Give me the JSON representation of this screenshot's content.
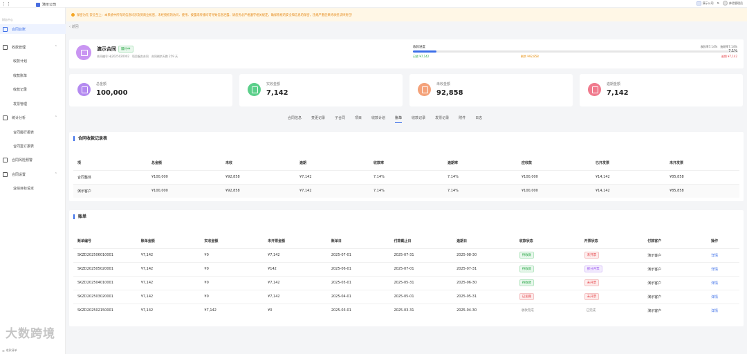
{
  "header": {
    "company": "演示公司",
    "right_company": "演示公司",
    "right_switch": "⇅",
    "user": "体验管理员"
  },
  "sidebar": {
    "section": "财务中心",
    "items": [
      {
        "label": "合同台账",
        "type": "item",
        "active": true
      },
      {
        "label": "收款管理",
        "type": "group"
      },
      {
        "label": "收款计划",
        "type": "sub"
      },
      {
        "label": "收款账单",
        "type": "sub"
      },
      {
        "label": "收款记录",
        "type": "sub"
      },
      {
        "label": "发票管理",
        "type": "sub"
      },
      {
        "label": "统计分析",
        "type": "group"
      },
      {
        "label": "合同履行报表",
        "type": "sub"
      },
      {
        "label": "合同签订报表",
        "type": "sub"
      },
      {
        "label": "合同风险预警",
        "type": "item"
      },
      {
        "label": "合同设置",
        "type": "group"
      },
      {
        "label": "业绩目标设定",
        "type": "sub"
      }
    ],
    "footer": "收款清单",
    "watermark": "大数跨境"
  },
  "notice": "保密为先 安全至上：本系统中所有的信息均涉及到商业机密，未经授权的访问、使用、披露或传播均可导致信息泄露，请您务必严格遵守相关规定，确保系统的安全和信息的保密，违规严重后果将承担法律责任！",
  "back": "返回",
  "contract": {
    "name": "演示合同",
    "status": "履约中",
    "meta": "合同编号 HJ2025020002　项目服务合同　合同剩余天数 259 天",
    "progress_label": "收款进度",
    "progress_pct_value": 7.14,
    "rate_text": "收款率7.14%　逾期率7.14%",
    "pct_text": "7.1%",
    "paid_text": "已收 ¥7,142",
    "remain_text": "剩余 ¥92,858",
    "overdue_text": "逾期 ¥7,142"
  },
  "stats": [
    {
      "label": "总金额",
      "value": "100,000",
      "color": "#b48af0"
    },
    {
      "label": "实收金额",
      "value": "7,142",
      "color": "#5bcf8a"
    },
    {
      "label": "未收金额",
      "value": "92,858",
      "color": "#f4a27a"
    },
    {
      "label": "逾期金额",
      "value": "7,142",
      "color": "#f07a8d"
    }
  ],
  "tabs": [
    "合同信息",
    "变更记录",
    "子合同",
    "项目",
    "收款计划",
    "账单",
    "收款记录",
    "发票记录",
    "附件",
    "日志"
  ],
  "active_tab": "账单",
  "summary": {
    "title": "合同收款记录表",
    "headers": [
      "项",
      "总金额",
      "未收",
      "逾期",
      "收款率",
      "逾期率",
      "应收款",
      "已开发票",
      "未开发票"
    ],
    "rows": [
      [
        "合同整体",
        "¥100,000",
        "¥92,858",
        "¥7,142",
        "7.14%",
        "7.14%",
        "¥100,000",
        "¥14,142",
        "¥85,858"
      ],
      [
        "演示客户",
        "¥100,000",
        "¥92,858",
        "¥7,142",
        "7.14%",
        "7.14%",
        "¥100,000",
        "¥14,142",
        "¥85,858"
      ]
    ]
  },
  "bills": {
    "title": "账单",
    "headers": [
      "账单编号",
      "账单金额",
      "实收金额",
      "未开票金额",
      "账单日",
      "付款截止日",
      "逾期日",
      "收款状态",
      "开票状态",
      "付款客户",
      "操作"
    ],
    "rows": [
      {
        "no": "SKZD202506010001",
        "amount": "¥7,142",
        "received": "¥0",
        "uninvoiced": "¥7,142",
        "bill_date": "2025-07-01",
        "due": "2025-07-31",
        "overdue": "2025-08-30",
        "status": "待收款",
        "status_tone": "green",
        "invoice": "未开票",
        "invoice_tone": "red",
        "customer": "演示客户",
        "action": "详情"
      },
      {
        "no": "SKZD202505020001",
        "amount": "¥7,142",
        "received": "¥0",
        "uninvoiced": "¥142",
        "bill_date": "2025-06-01",
        "due": "2025-07-01",
        "overdue": "2025-07-31",
        "status": "待收款",
        "status_tone": "green",
        "invoice": "部分开票",
        "invoice_tone": "purple",
        "customer": "演示客户",
        "action": "详情"
      },
      {
        "no": "SKZD202504010001",
        "amount": "¥7,142",
        "received": "¥0",
        "uninvoiced": "¥7,142",
        "bill_date": "2025-05-01",
        "due": "2025-05-31",
        "overdue": "2025-06-30",
        "status": "待收款",
        "status_tone": "green",
        "invoice": "未开票",
        "invoice_tone": "red",
        "customer": "演示客户",
        "action": "详情"
      },
      {
        "no": "SKZD202503020001",
        "amount": "¥7,142",
        "received": "¥0",
        "uninvoiced": "¥7,142",
        "bill_date": "2025-04-01",
        "due": "2025-05-01",
        "overdue": "2025-05-31",
        "status": "已逾期",
        "status_tone": "red",
        "invoice": "未开票",
        "invoice_tone": "red",
        "customer": "演示客户",
        "action": "详情"
      },
      {
        "no": "SKZD202502150001",
        "amount": "¥7,142",
        "received": "¥7,142",
        "uninvoiced": "¥0",
        "bill_date": "2025-03-01",
        "due": "2025-03-31",
        "overdue": "2025-04-30",
        "status": "收款完成",
        "status_tone": "plain",
        "invoice": "已完成",
        "invoice_tone": "plain",
        "customer": "演示客户",
        "action": "详情"
      }
    ]
  }
}
